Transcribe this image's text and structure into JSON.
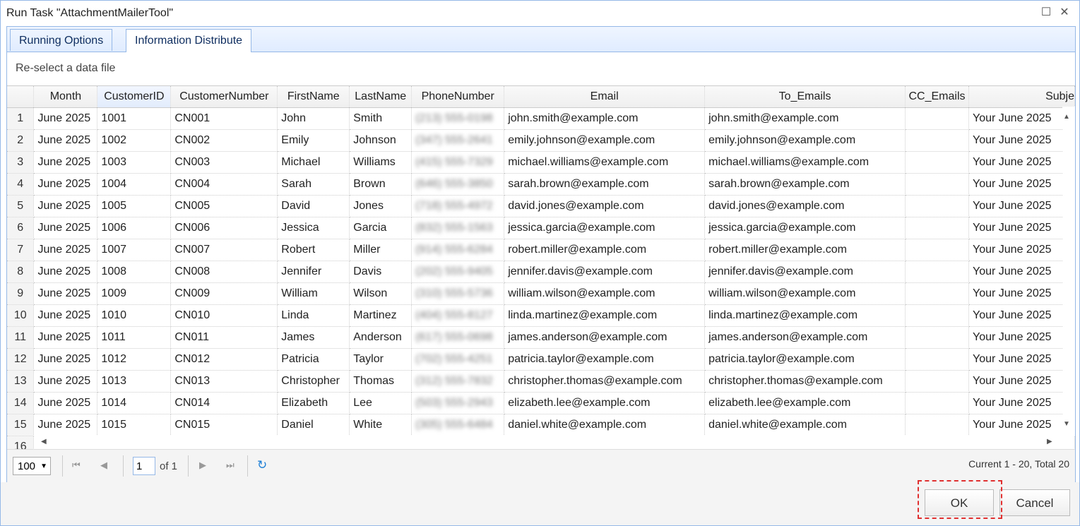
{
  "window": {
    "title": "Run Task \"AttachmentMailerTool\""
  },
  "tabs": [
    {
      "label": "Running Options"
    },
    {
      "label": "Information Distribute"
    }
  ],
  "toolbar": {
    "reselect_label": "Re-select a data file"
  },
  "table": {
    "columns": [
      "Month",
      "CustomerID",
      "CustomerNumber",
      "FirstName",
      "LastName",
      "PhoneNumber",
      "Email",
      "To_Emails",
      "CC_Emails",
      "Subje"
    ],
    "rows": [
      [
        "1",
        "June 2025",
        "1001",
        "CN001",
        "John",
        "Smith",
        "(213) 555-0198",
        "john.smith@example.com",
        "john.smith@example.com",
        "",
        "Your June 2025"
      ],
      [
        "2",
        "June 2025",
        "1002",
        "CN002",
        "Emily",
        "Johnson",
        "(347) 555-2641",
        "emily.johnson@example.com",
        "emily.johnson@example.com",
        "",
        "Your June 2025"
      ],
      [
        "3",
        "June 2025",
        "1003",
        "CN003",
        "Michael",
        "Williams",
        "(415) 555-7329",
        "michael.williams@example.com",
        "michael.williams@example.com",
        "",
        "Your June 2025"
      ],
      [
        "4",
        "June 2025",
        "1004",
        "CN004",
        "Sarah",
        "Brown",
        "(646) 555-3850",
        "sarah.brown@example.com",
        "sarah.brown@example.com",
        "",
        "Your June 2025"
      ],
      [
        "5",
        "June 2025",
        "1005",
        "CN005",
        "David",
        "Jones",
        "(718) 555-4972",
        "david.jones@example.com",
        "david.jones@example.com",
        "",
        "Your June 2025"
      ],
      [
        "6",
        "June 2025",
        "1006",
        "CN006",
        "Jessica",
        "Garcia",
        "(832) 555-1563",
        "jessica.garcia@example.com",
        "jessica.garcia@example.com",
        "",
        "Your June 2025"
      ],
      [
        "7",
        "June 2025",
        "1007",
        "CN007",
        "Robert",
        "Miller",
        "(914) 555-6284",
        "robert.miller@example.com",
        "robert.miller@example.com",
        "",
        "Your June 2025"
      ],
      [
        "8",
        "June 2025",
        "1008",
        "CN008",
        "Jennifer",
        "Davis",
        "(202) 555-9405",
        "jennifer.davis@example.com",
        "jennifer.davis@example.com",
        "",
        "Your June 2025"
      ],
      [
        "9",
        "June 2025",
        "1009",
        "CN009",
        "William",
        "Wilson",
        "(310) 555-5736",
        "william.wilson@example.com",
        "william.wilson@example.com",
        "",
        "Your June 2025"
      ],
      [
        "10",
        "June 2025",
        "1010",
        "CN010",
        "Linda",
        "Martinez",
        "(404) 555-8127",
        "linda.martinez@example.com",
        "linda.martinez@example.com",
        "",
        "Your June 2025"
      ],
      [
        "11",
        "June 2025",
        "1011",
        "CN011",
        "James",
        "Anderson",
        "(617) 555-0698",
        "james.anderson@example.com",
        "james.anderson@example.com",
        "",
        "Your June 2025"
      ],
      [
        "12",
        "June 2025",
        "1012",
        "CN012",
        "Patricia",
        "Taylor",
        "(702) 555-4251",
        "patricia.taylor@example.com",
        "patricia.taylor@example.com",
        "",
        "Your June 2025"
      ],
      [
        "13",
        "June 2025",
        "1013",
        "CN013",
        "Christopher",
        "Thomas",
        "(312) 555-7832",
        "christopher.thomas@example.com",
        "christopher.thomas@example.com",
        "",
        "Your June 2025"
      ],
      [
        "14",
        "June 2025",
        "1014",
        "CN014",
        "Elizabeth",
        "Lee",
        "(503) 555-2943",
        "elizabeth.lee@example.com",
        "elizabeth.lee@example.com",
        "",
        "Your June 2025"
      ],
      [
        "15",
        "June 2025",
        "1015",
        "CN015",
        "Daniel",
        "White",
        "(305) 555-6484",
        "daniel.white@example.com",
        "daniel.white@example.com",
        "",
        "Your June 2025"
      ],
      [
        "16",
        "",
        "",
        "",
        "",
        "",
        "",
        "",
        "",
        "",
        ""
      ]
    ]
  },
  "pager": {
    "page_size": "100",
    "page_number": "1",
    "of_label": "of 1",
    "info": "Current 1 - 20, Total 20"
  },
  "buttons": {
    "ok": "OK",
    "cancel": "Cancel"
  },
  "colors": {
    "border_blue": "#95b8e7",
    "highlight_red": "#e03030",
    "refresh_blue": "#1e7fd6"
  }
}
